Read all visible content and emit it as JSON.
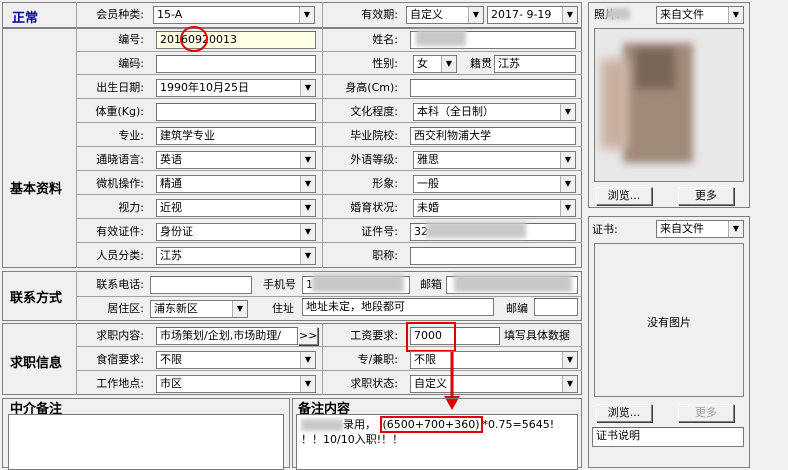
{
  "sections": {
    "normal": "正常",
    "basic": "基本资料",
    "contact": "联系方式",
    "job": "求职信息",
    "agent_note": "中介备注",
    "remark": "备注内容"
  },
  "row1": {
    "member_type_label": "会员种类:",
    "member_type_value": "15-A",
    "validity_label": "有效期:",
    "validity_mode": "自定义",
    "validity_date": "2017- 9-19"
  },
  "basic": {
    "number_label": "编号:",
    "number_value": "20160920013",
    "name_label": "姓名:",
    "name_value": "",
    "code_label": "编码:",
    "code_value": "",
    "gender_label": "性别:",
    "gender_value": "女",
    "native_label": "籍贯",
    "native_value": "江苏",
    "birth_label": "出生日期:",
    "birth_value": "1990年10月25日",
    "height_label": "身高(Cm):",
    "height_value": "",
    "weight_label": "体重(Kg):",
    "weight_value": "",
    "edu_label": "文化程度:",
    "edu_value": "本科（全日制）",
    "major_label": "专业:",
    "major_value": "建筑学专业",
    "school_label": "毕业院校:",
    "school_value": "西交利物浦大学",
    "lang_label": "通晓语言:",
    "lang_value": "英语",
    "flang_label": "外语等级:",
    "flang_value": "雅思",
    "pc_label": "微机操作:",
    "pc_value": "精通",
    "image_label": "形象:",
    "image_value": "一般",
    "vision_label": "视力:",
    "vision_value": "近视",
    "marital_label": "婚育状况:",
    "marital_value": "未婚",
    "id_type_label": "有效证件:",
    "id_type_value": "身份证",
    "id_no_label": "证件号:",
    "id_no_value": "32",
    "category_label": "人员分类:",
    "category_value": "江苏",
    "title_label": "职称:",
    "title_value": ""
  },
  "contact": {
    "phone_label": "联系电话:",
    "phone_value": "",
    "mobile_label": "手机号",
    "mobile_value": "1",
    "email_label": "邮箱",
    "email_value": "",
    "area_label": "居住区:",
    "area_value": "浦东新区",
    "address_label": "住址",
    "address_value": "地址未定，地段都可",
    "zip_label": "邮编",
    "zip_value": ""
  },
  "job": {
    "want_label": "求职内容:",
    "want_value": "市场策划/企划,市场助理/",
    "more_btn": ">>",
    "salary_label": "工资要求:",
    "salary_value": "7000",
    "salary_hint": "填写具体数据",
    "board_label": "食宿要求:",
    "board_value": "不限",
    "parttime_label": "专/兼职:",
    "parttime_value": "不限",
    "location_label": "工作地点:",
    "location_value": "市区",
    "status_label": "求职状态:",
    "status_value": "自定义"
  },
  "notes": {
    "agent_text": "",
    "remark_line1_a": "录用，",
    "remark_line1_b": "(6500+700+360)",
    "remark_line1_c": "*0.75=5645!",
    "remark_line2": "！！10/10入职!！！"
  },
  "photo": {
    "label": "照片:",
    "source": "来自文件",
    "browse": "浏览...",
    "more": "更多"
  },
  "cert": {
    "label": "证书:",
    "source": "来自文件",
    "no_image": "没有图片",
    "browse": "浏览...",
    "more": "更多",
    "desc": "证书说明"
  }
}
